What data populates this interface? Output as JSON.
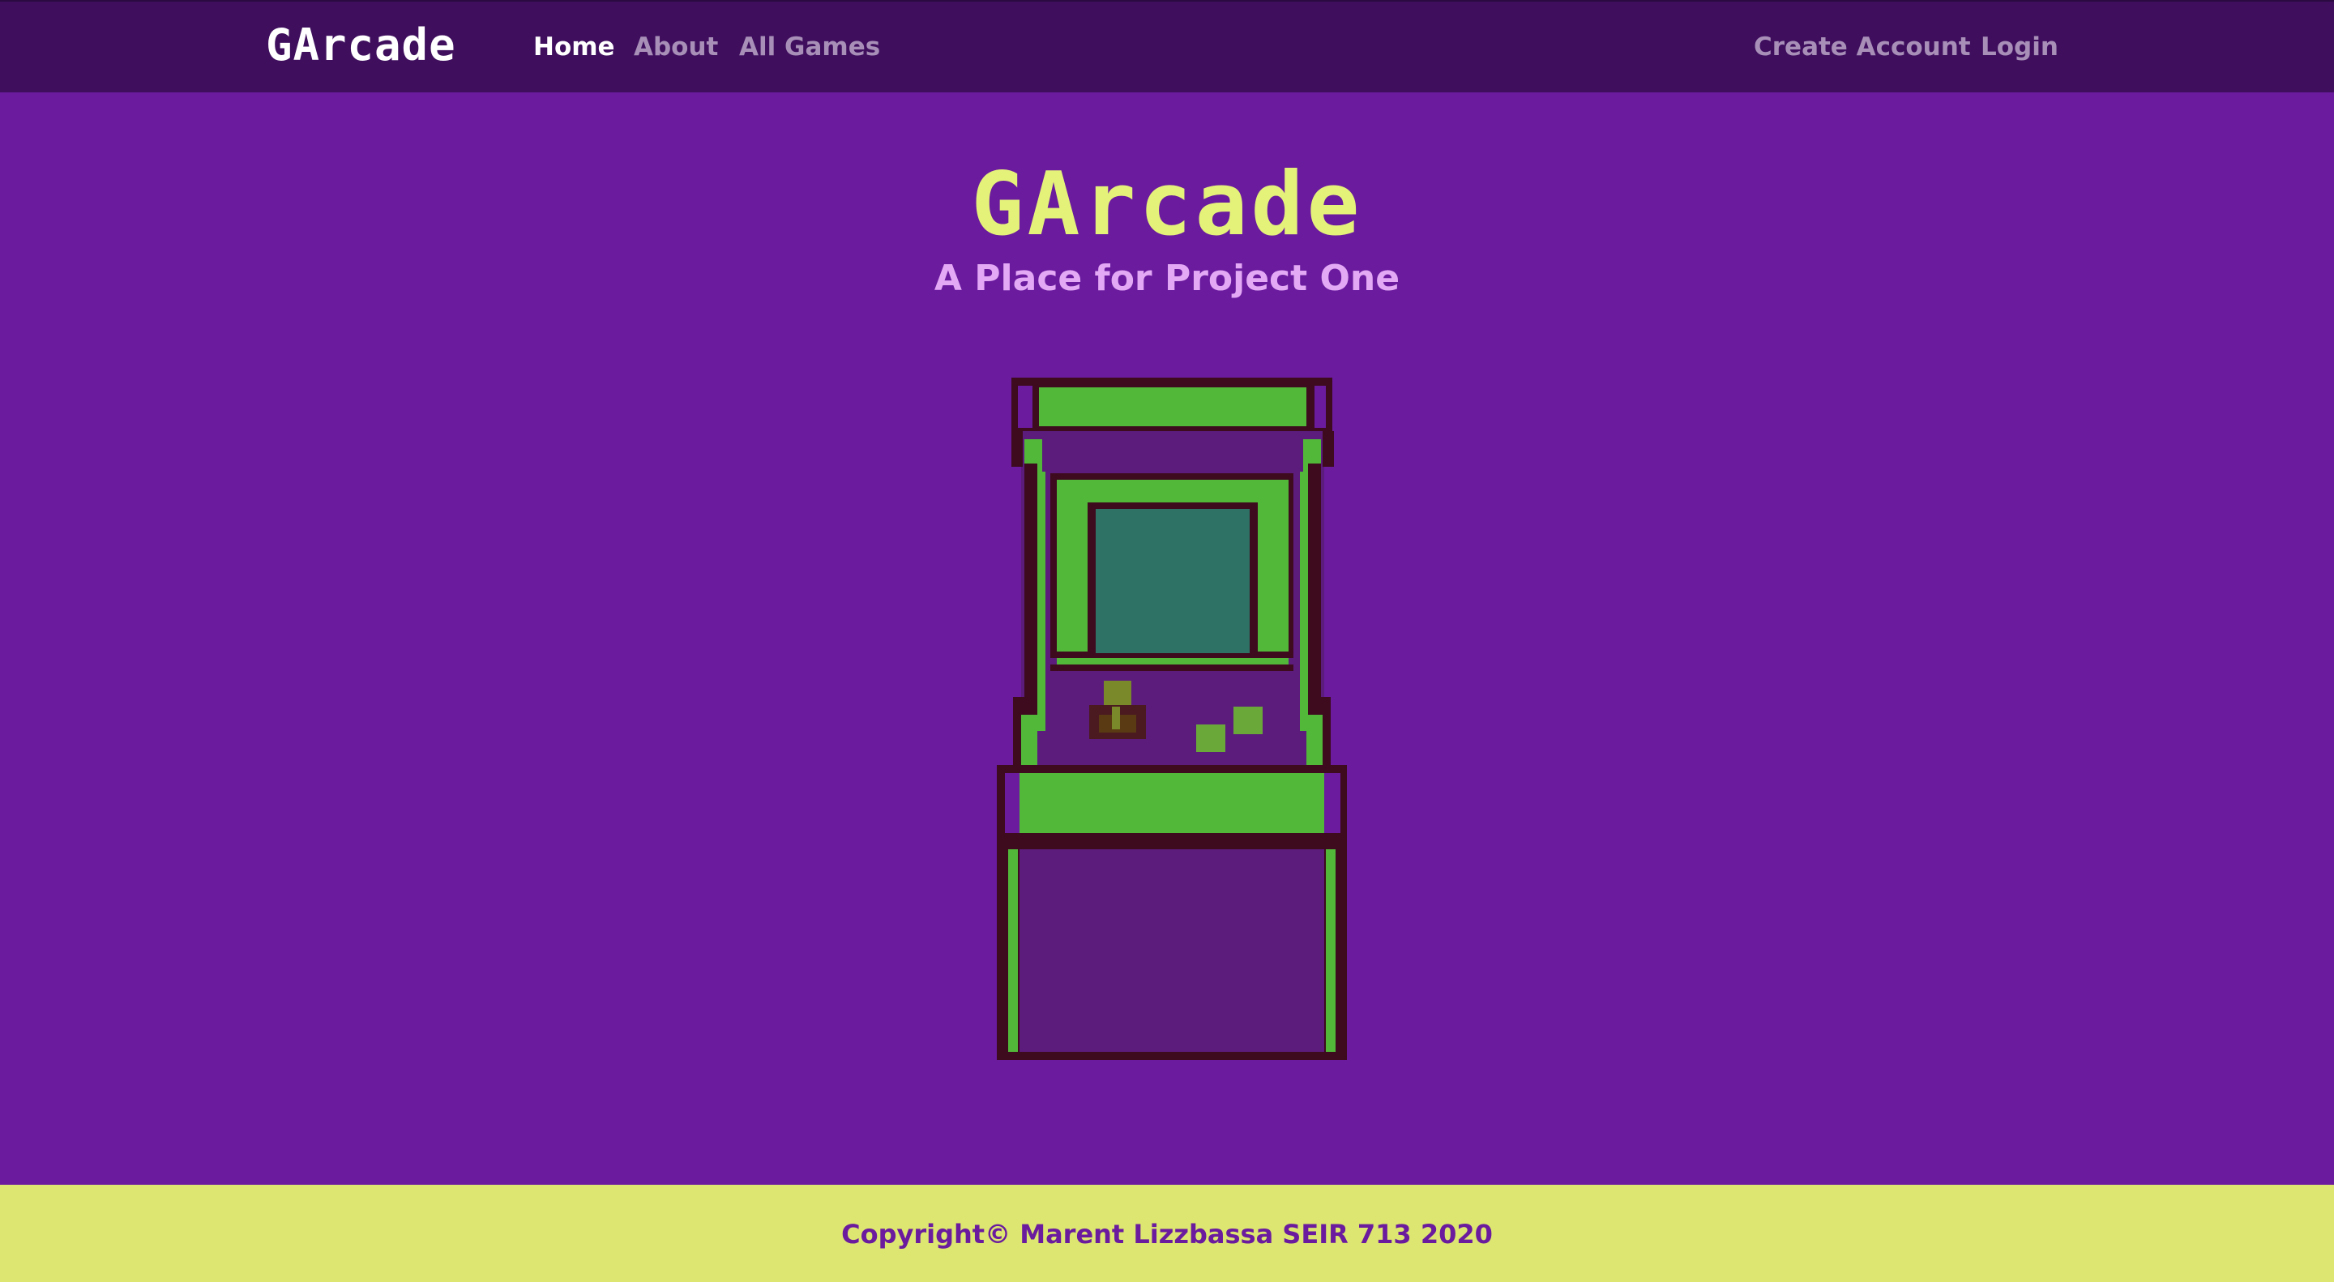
{
  "nav": {
    "brand": "GArcade",
    "links": [
      {
        "label": "Home",
        "active": true
      },
      {
        "label": "About",
        "active": false
      },
      {
        "label": "All Games",
        "active": false
      }
    ],
    "auth": {
      "create_account": "Create Account",
      "login": "Login"
    }
  },
  "hero": {
    "title": "GArcade",
    "subtitle": "A Place for Project One",
    "image_icon": "arcade-cabinet-icon"
  },
  "footer": {
    "copyright": "Copyright© Marent Lizzbassa SEIR 713 2020"
  },
  "colors": {
    "navbar_bg": "#3f0f5e",
    "page_bg": "#6a1b9e",
    "title": "#e5f27a",
    "subtitle": "#e3a9f5",
    "footer_bg": "#dde670",
    "cabinet_green": "#52b83a",
    "cabinet_outline": "#3d0a1e",
    "screen": "#2e7266"
  }
}
